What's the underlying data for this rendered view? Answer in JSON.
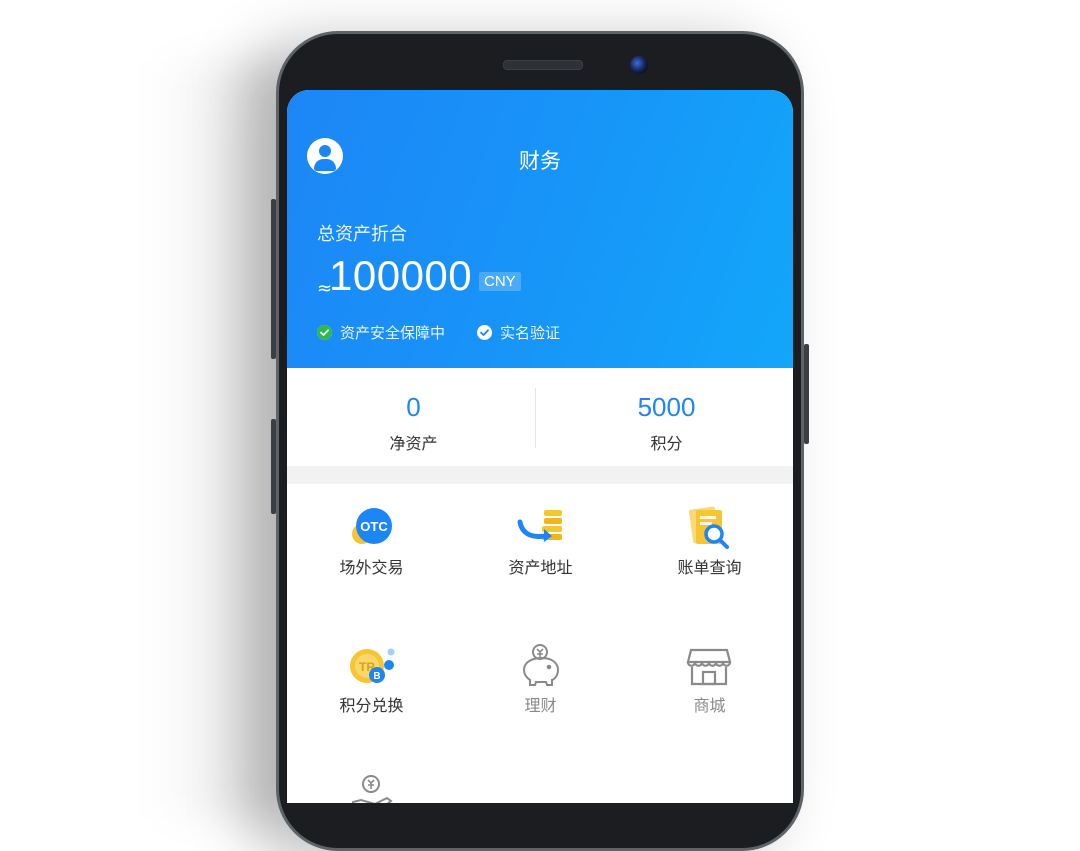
{
  "header": {
    "title": "财务",
    "total_label": "总资产折合",
    "approx_symbol": "≈",
    "amount": "100000",
    "currency": "CNY",
    "badges": [
      {
        "label": "资产安全保障中",
        "icon": "green-check-icon"
      },
      {
        "label": "实名验证",
        "icon": "white-check-icon"
      }
    ]
  },
  "stats": [
    {
      "value": "0",
      "label": "净资产"
    },
    {
      "value": "5000",
      "label": "积分"
    }
  ],
  "grid": [
    {
      "label": "场外交易",
      "icon": "otc-icon",
      "icon_text": "OTC"
    },
    {
      "label": "资产地址",
      "icon": "asset-address-icon"
    },
    {
      "label": "账单查询",
      "icon": "bill-query-icon"
    },
    {
      "label": "积分兑换",
      "icon": "points-exchange-icon"
    },
    {
      "label": "理财",
      "icon": "piggy-bank-icon"
    },
    {
      "label": "商城",
      "icon": "store-icon"
    },
    {
      "label": "",
      "icon": "yuan-hand-icon"
    }
  ],
  "colors": {
    "accent": "#1d86f6",
    "header_gradient_end": "#12a7fb",
    "gold": "#f7c531"
  }
}
